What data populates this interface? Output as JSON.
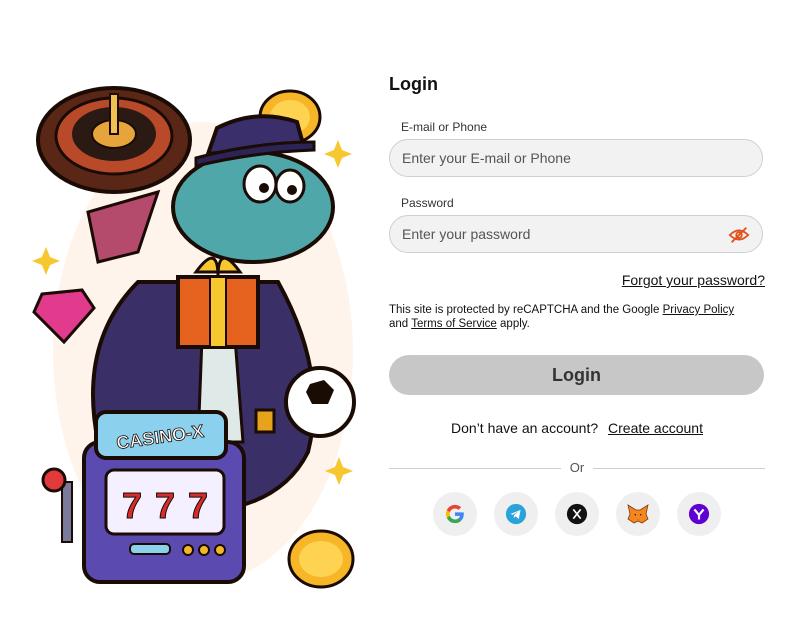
{
  "illustration": {
    "sign_text": "CASINO-X",
    "reels": [
      "7",
      "7",
      "7"
    ]
  },
  "login": {
    "title": "Login",
    "email_label": "E-mail or Phone",
    "email_placeholder": "Enter your E-mail or Phone",
    "password_label": "Password",
    "password_placeholder": "Enter your password",
    "forgot_password": "Forgot your password?",
    "recaptcha_prefix": "This site is protected by reCAPTCHA and the Google",
    "privacy_policy": "Privacy Policy",
    "recaptcha_and": "and",
    "terms_of_service": "Terms of Service",
    "recaptcha_suffix": "apply.",
    "submit_label": "Login",
    "no_account": "Don’t have an account?",
    "create_account": "Create account",
    "divider_or": "Or"
  },
  "socials": [
    {
      "icon": "google-icon"
    },
    {
      "icon": "telegram-icon"
    },
    {
      "icon": "x-icon"
    },
    {
      "icon": "metamask-icon"
    },
    {
      "icon": "yahoo-icon"
    }
  ],
  "colors": {
    "button_bg": "#c7c7c7",
    "field_bg": "#f2f2f2",
    "eye_icon": "#e0521b",
    "telegram": "#2aa3db",
    "yahoo": "#5f01d1"
  }
}
